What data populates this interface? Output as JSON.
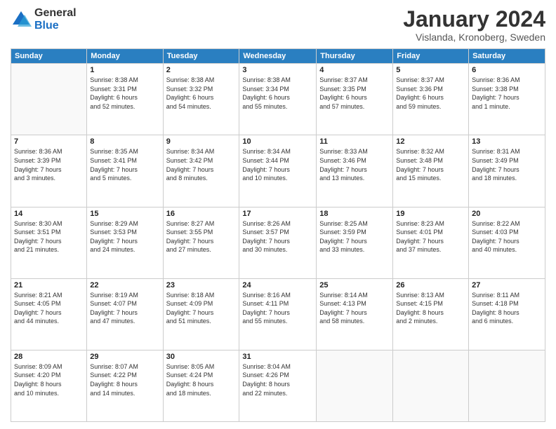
{
  "logo": {
    "general": "General",
    "blue": "Blue"
  },
  "header": {
    "month": "January 2024",
    "location": "Vislanda, Kronoberg, Sweden"
  },
  "weekdays": [
    "Sunday",
    "Monday",
    "Tuesday",
    "Wednesday",
    "Thursday",
    "Friday",
    "Saturday"
  ],
  "weeks": [
    [
      {
        "day": "",
        "info": ""
      },
      {
        "day": "1",
        "info": "Sunrise: 8:38 AM\nSunset: 3:31 PM\nDaylight: 6 hours\nand 52 minutes."
      },
      {
        "day": "2",
        "info": "Sunrise: 8:38 AM\nSunset: 3:32 PM\nDaylight: 6 hours\nand 54 minutes."
      },
      {
        "day": "3",
        "info": "Sunrise: 8:38 AM\nSunset: 3:34 PM\nDaylight: 6 hours\nand 55 minutes."
      },
      {
        "day": "4",
        "info": "Sunrise: 8:37 AM\nSunset: 3:35 PM\nDaylight: 6 hours\nand 57 minutes."
      },
      {
        "day": "5",
        "info": "Sunrise: 8:37 AM\nSunset: 3:36 PM\nDaylight: 6 hours\nand 59 minutes."
      },
      {
        "day": "6",
        "info": "Sunrise: 8:36 AM\nSunset: 3:38 PM\nDaylight: 7 hours\nand 1 minute."
      }
    ],
    [
      {
        "day": "7",
        "info": "Sunrise: 8:36 AM\nSunset: 3:39 PM\nDaylight: 7 hours\nand 3 minutes."
      },
      {
        "day": "8",
        "info": "Sunrise: 8:35 AM\nSunset: 3:41 PM\nDaylight: 7 hours\nand 5 minutes."
      },
      {
        "day": "9",
        "info": "Sunrise: 8:34 AM\nSunset: 3:42 PM\nDaylight: 7 hours\nand 8 minutes."
      },
      {
        "day": "10",
        "info": "Sunrise: 8:34 AM\nSunset: 3:44 PM\nDaylight: 7 hours\nand 10 minutes."
      },
      {
        "day": "11",
        "info": "Sunrise: 8:33 AM\nSunset: 3:46 PM\nDaylight: 7 hours\nand 13 minutes."
      },
      {
        "day": "12",
        "info": "Sunrise: 8:32 AM\nSunset: 3:48 PM\nDaylight: 7 hours\nand 15 minutes."
      },
      {
        "day": "13",
        "info": "Sunrise: 8:31 AM\nSunset: 3:49 PM\nDaylight: 7 hours\nand 18 minutes."
      }
    ],
    [
      {
        "day": "14",
        "info": "Sunrise: 8:30 AM\nSunset: 3:51 PM\nDaylight: 7 hours\nand 21 minutes."
      },
      {
        "day": "15",
        "info": "Sunrise: 8:29 AM\nSunset: 3:53 PM\nDaylight: 7 hours\nand 24 minutes."
      },
      {
        "day": "16",
        "info": "Sunrise: 8:27 AM\nSunset: 3:55 PM\nDaylight: 7 hours\nand 27 minutes."
      },
      {
        "day": "17",
        "info": "Sunrise: 8:26 AM\nSunset: 3:57 PM\nDaylight: 7 hours\nand 30 minutes."
      },
      {
        "day": "18",
        "info": "Sunrise: 8:25 AM\nSunset: 3:59 PM\nDaylight: 7 hours\nand 33 minutes."
      },
      {
        "day": "19",
        "info": "Sunrise: 8:23 AM\nSunset: 4:01 PM\nDaylight: 7 hours\nand 37 minutes."
      },
      {
        "day": "20",
        "info": "Sunrise: 8:22 AM\nSunset: 4:03 PM\nDaylight: 7 hours\nand 40 minutes."
      }
    ],
    [
      {
        "day": "21",
        "info": "Sunrise: 8:21 AM\nSunset: 4:05 PM\nDaylight: 7 hours\nand 44 minutes."
      },
      {
        "day": "22",
        "info": "Sunrise: 8:19 AM\nSunset: 4:07 PM\nDaylight: 7 hours\nand 47 minutes."
      },
      {
        "day": "23",
        "info": "Sunrise: 8:18 AM\nSunset: 4:09 PM\nDaylight: 7 hours\nand 51 minutes."
      },
      {
        "day": "24",
        "info": "Sunrise: 8:16 AM\nSunset: 4:11 PM\nDaylight: 7 hours\nand 55 minutes."
      },
      {
        "day": "25",
        "info": "Sunrise: 8:14 AM\nSunset: 4:13 PM\nDaylight: 7 hours\nand 58 minutes."
      },
      {
        "day": "26",
        "info": "Sunrise: 8:13 AM\nSunset: 4:15 PM\nDaylight: 8 hours\nand 2 minutes."
      },
      {
        "day": "27",
        "info": "Sunrise: 8:11 AM\nSunset: 4:18 PM\nDaylight: 8 hours\nand 6 minutes."
      }
    ],
    [
      {
        "day": "28",
        "info": "Sunrise: 8:09 AM\nSunset: 4:20 PM\nDaylight: 8 hours\nand 10 minutes."
      },
      {
        "day": "29",
        "info": "Sunrise: 8:07 AM\nSunset: 4:22 PM\nDaylight: 8 hours\nand 14 minutes."
      },
      {
        "day": "30",
        "info": "Sunrise: 8:05 AM\nSunset: 4:24 PM\nDaylight: 8 hours\nand 18 minutes."
      },
      {
        "day": "31",
        "info": "Sunrise: 8:04 AM\nSunset: 4:26 PM\nDaylight: 8 hours\nand 22 minutes."
      },
      {
        "day": "",
        "info": ""
      },
      {
        "day": "",
        "info": ""
      },
      {
        "day": "",
        "info": ""
      }
    ]
  ]
}
